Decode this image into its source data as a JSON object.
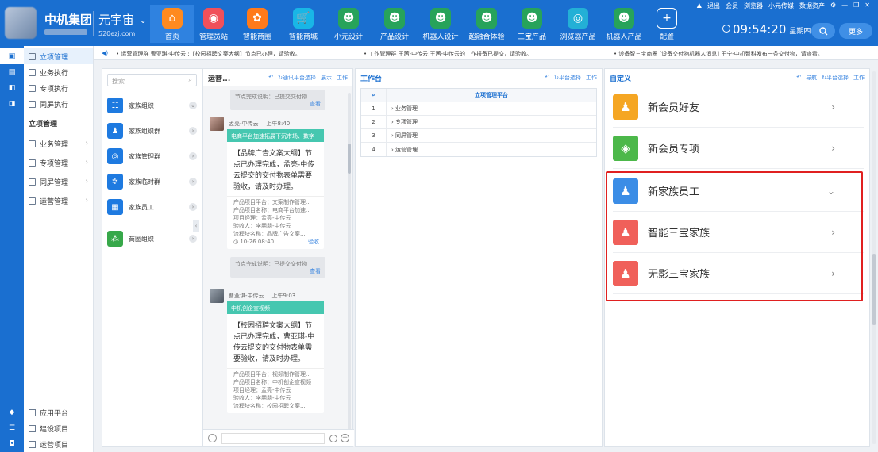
{
  "header": {
    "brand": "中机集团",
    "universe": "元宇宙",
    "universe_url": "520ezj.com",
    "nav": [
      {
        "label": "首页",
        "color": "#ff8a1f",
        "icon": "⌂"
      },
      {
        "label": "管理员站",
        "color": "#f0505a",
        "icon": "◉"
      },
      {
        "label": "智能商圈",
        "color": "#ff7a1a",
        "icon": "✿"
      },
      {
        "label": "智能商城",
        "color": "#19b6e6",
        "icon": "🛒"
      },
      {
        "label": "小元设计",
        "color": "#27a35a",
        "icon": "☻"
      },
      {
        "label": "产品设计",
        "color": "#27a35a",
        "icon": "☻"
      },
      {
        "label": "机器人设计",
        "color": "#27a35a",
        "icon": "☻"
      },
      {
        "label": "超融合体验",
        "color": "#27a35a",
        "icon": "☻"
      },
      {
        "label": "三宝产品",
        "color": "#27a35a",
        "icon": "☻"
      },
      {
        "label": "浏览器产品",
        "color": "#23b0d6",
        "icon": "◎"
      },
      {
        "label": "机器人产品",
        "color": "#27a35a",
        "icon": "☻"
      },
      {
        "label": "配置",
        "color": "#1a6fd0",
        "icon": "+"
      }
    ],
    "top_links": [
      "退出",
      "会员",
      "浏览器",
      "小元传媒",
      "数据资产"
    ],
    "clock": "09:54:20",
    "weekday": "星期四",
    "more_label": "更多"
  },
  "left_nav": {
    "items": [
      {
        "label": "立项管理",
        "active": true
      },
      {
        "label": "业务执行"
      },
      {
        "label": "专项执行"
      },
      {
        "label": "同屏执行"
      }
    ],
    "section_title": "立项管理",
    "sub_items": [
      {
        "label": "业务管理"
      },
      {
        "label": "专项管理"
      },
      {
        "label": "同屏管理"
      },
      {
        "label": "运营管理"
      }
    ],
    "bottom": [
      {
        "label": "应用平台"
      },
      {
        "label": "建设项目"
      },
      {
        "label": "运营项目"
      }
    ]
  },
  "ticker": {
    "msg1": "• 运营管理群 曹亚琪-中传云 :【校园招聘文案大纲】节点已办理，请验收。",
    "msg2": "• 工作管理群 王茜-中传云:王茜-中传云的工作报备已提交，请验收。",
    "msg3": "• 设备智三宝商圈 [设备交付物机器人消息] 王宁-中机智科发布一条交付物，请查看。"
  },
  "panel_family": {
    "search_placeholder": "搜索",
    "items": [
      {
        "label": "家族组织"
      },
      {
        "label": "家族组织群"
      },
      {
        "label": "家族管理群"
      },
      {
        "label": "家族临时群"
      },
      {
        "label": "家族员工"
      },
      {
        "label": "商圈组织"
      }
    ]
  },
  "panel_chat": {
    "title": "运营...",
    "tools": [
      "↻通讯平台选择",
      "展示",
      "工作"
    ],
    "sys_msg": "节点完成说明：已提交交付物",
    "sys_look": "查看",
    "messages": [
      {
        "sender": "孟亮-中传云",
        "time": "上午8:40",
        "bar": "电商平台加速拓展下沉市场、数字",
        "body": "【品牌广告文案大纲】节点已办理完成，孟亮-中传云提交的交付物表单需要验收，请及时办理。",
        "meta": [
          "产品项目平台：文案制作管理...",
          "产品项目名称：电商平台加速...",
          "项目经理：孟亮-中传云",
          "验收人：李朋朋-中传云",
          "流程块名称：品牌广告文案..."
        ],
        "stamp": "10-26 08:40",
        "action": "验收"
      },
      {
        "sender": "曹亚琪-中传云",
        "time": "上午9:03",
        "bar": "中机创企宣视频",
        "body": "【校园招聘文案大纲】节点已办理完成，曹亚琪-中传云提交的交付物表单需要验收，请及时办理。",
        "meta": [
          "产品项目平台：视频制作管理...",
          "产品项目名称：中机创企宣视频",
          "项目经理：孟亮-中传云",
          "验收人：李朋朋-中传云",
          "流程块名称：校园招聘文案..."
        ]
      }
    ]
  },
  "panel_work": {
    "title": "工作台",
    "tools": [
      "↻平台选择",
      "工作"
    ],
    "table_header": "立项管理平台",
    "rows": [
      {
        "num": "1",
        "label": "业务管理"
      },
      {
        "num": "2",
        "label": "专项管理"
      },
      {
        "num": "3",
        "label": "同屏管理"
      },
      {
        "num": "4",
        "label": "运营管理"
      }
    ]
  },
  "panel_custom": {
    "title": "自定义",
    "tools": [
      "导航",
      "↻平台选择",
      "工作"
    ],
    "menu": [
      {
        "label": "新会员好友",
        "color": "#f5a623",
        "arrow": "›"
      },
      {
        "label": "新会员专项",
        "color": "#4cb84a",
        "arrow": "›"
      },
      {
        "label": "新家族员工",
        "color": "#3b8de6",
        "arrow": "⌄"
      },
      {
        "label": "智能三宝家族",
        "color": "#f0605a",
        "arrow": "›"
      },
      {
        "label": "无影三宝家族",
        "color": "#f0605a",
        "arrow": "›"
      }
    ]
  }
}
